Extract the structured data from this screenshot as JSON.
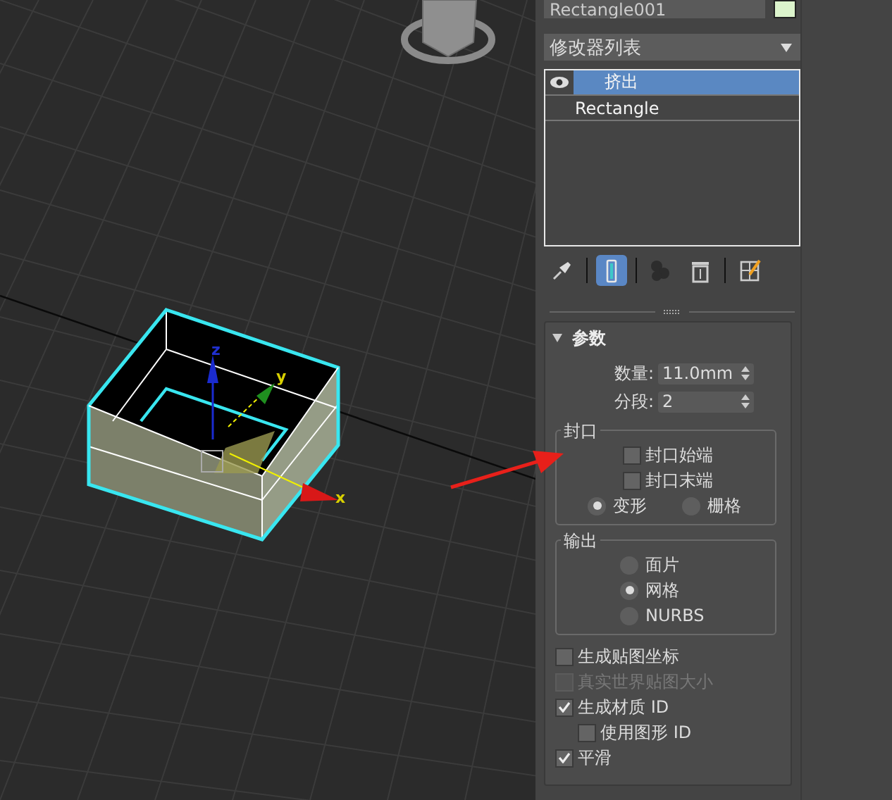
{
  "viewport": {
    "axis_labels": [
      {
        "kind": "up",
        "label": "z"
      },
      {
        "kind": "depth",
        "label": "y"
      },
      {
        "kind": "side",
        "label": "x"
      }
    ]
  },
  "object_name": {
    "value": "Rectangle001"
  },
  "modifier_list": {
    "label": "修改器列表"
  },
  "modifier_stack": [
    {
      "kind": "modifier",
      "label": "挤出",
      "selected": true
    },
    {
      "kind": "base",
      "label": "Rectangle",
      "selected": false
    }
  ],
  "stack_toolbar": [
    {
      "kind": "pin",
      "selected": false,
      "disabled": false
    },
    {
      "kind": "end-result",
      "selected": true,
      "disabled": false
    },
    {
      "kind": "unique",
      "selected": false,
      "disabled": true
    },
    {
      "kind": "remove",
      "selected": false,
      "disabled": false
    },
    {
      "kind": "configure",
      "selected": false,
      "disabled": false
    }
  ],
  "rollout": {
    "title": "参数",
    "expanded": true,
    "spinners": [
      {
        "label": "数量:",
        "value": "11.0mm"
      },
      {
        "label": "分段:",
        "value": "2"
      }
    ],
    "capping": {
      "title": "封口",
      "checkboxes": [
        {
          "label": "封口始端",
          "checked": false
        },
        {
          "label": "封口末端",
          "checked": false
        }
      ],
      "radios": [
        {
          "label": "变形",
          "selected": true
        },
        {
          "label": "栅格",
          "selected": false
        }
      ]
    },
    "output": {
      "title": "输出",
      "radios": [
        {
          "label": "面片",
          "selected": false
        },
        {
          "label": "网格",
          "selected": true
        },
        {
          "label": "NURBS",
          "selected": false
        }
      ]
    },
    "checkboxes": [
      {
        "label": "生成贴图坐标",
        "checked": false,
        "disabled": false
      },
      {
        "label": "真实世界贴图大小",
        "checked": false,
        "disabled": true
      },
      {
        "label": "生成材质 ID",
        "checked": true,
        "disabled": false,
        "children": [
          {
            "label": "使用图形 ID",
            "checked": false,
            "disabled": false
          }
        ]
      },
      {
        "label": "平滑",
        "checked": true,
        "disabled": false
      }
    ]
  }
}
